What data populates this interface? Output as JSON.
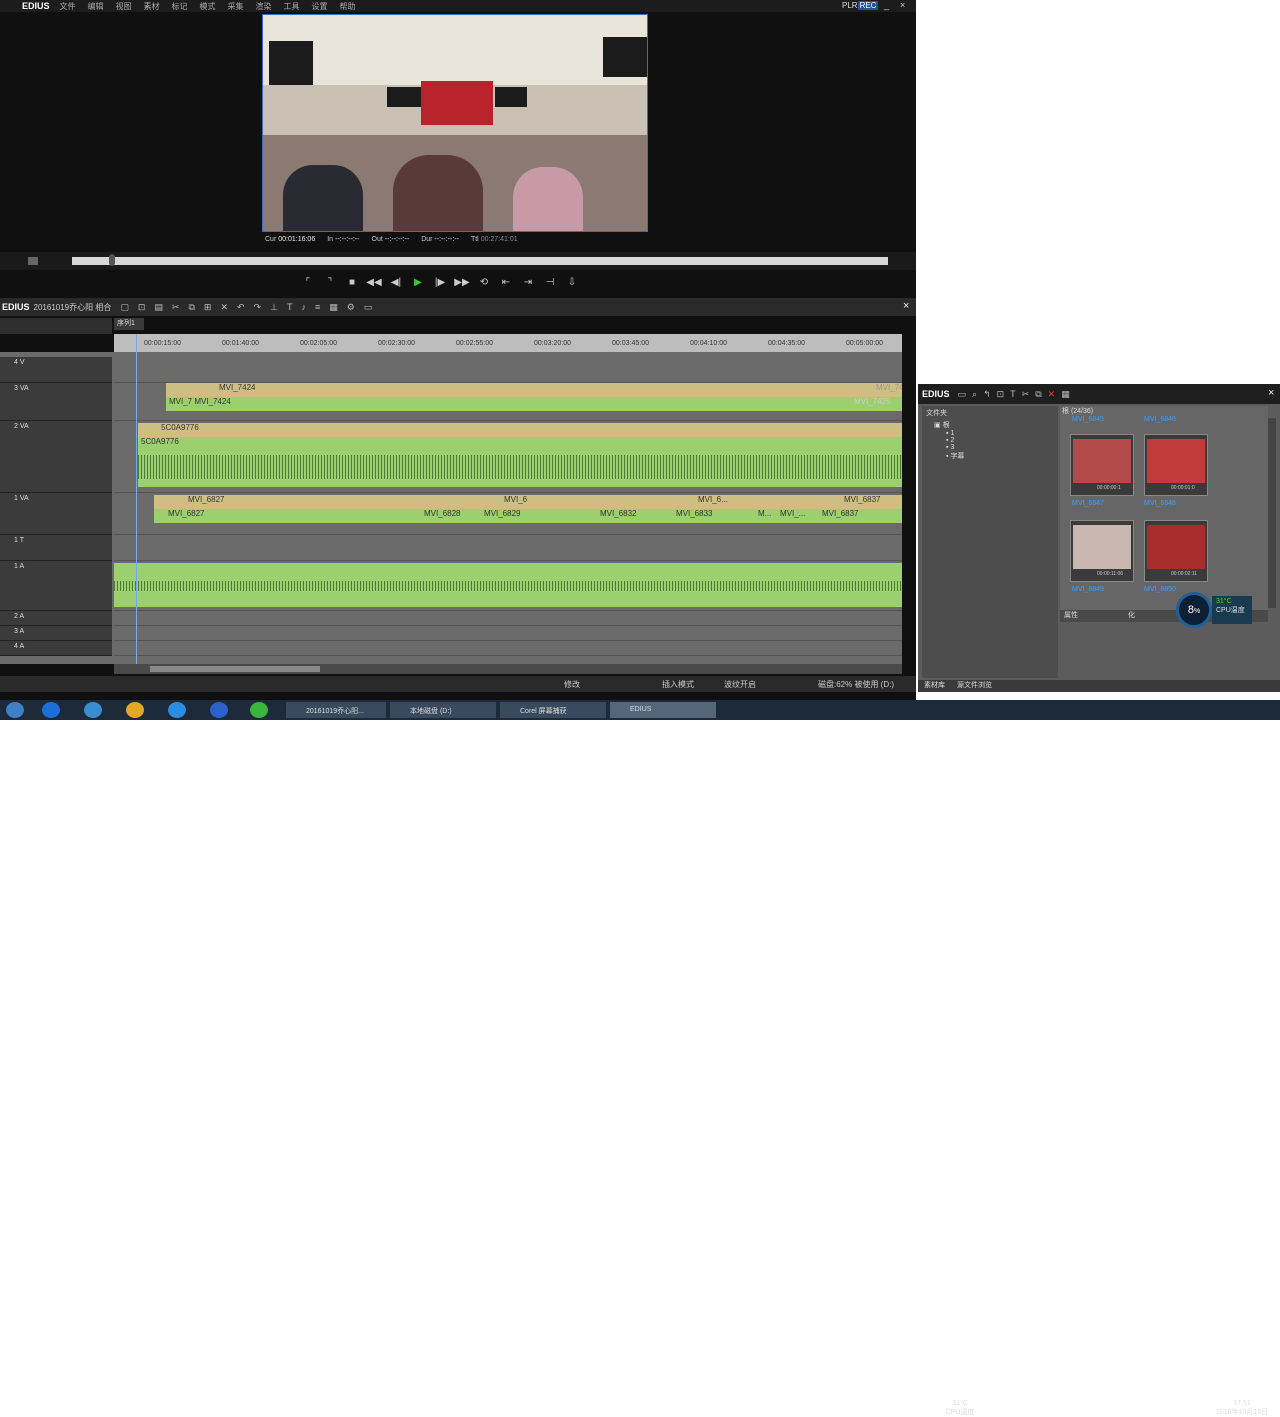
{
  "menubar": {
    "logo": "EDIUS",
    "items": [
      "文件",
      "编辑",
      "视图",
      "素材",
      "标记",
      "模式",
      "采集",
      "渲染",
      "工具",
      "设置",
      "帮助"
    ],
    "plr": "PLR",
    "rec": "REC",
    "min": "_",
    "close": "×"
  },
  "timecode": {
    "cur_label": "Cur",
    "cur": "00:01:16:06",
    "in_label": "In",
    "in": "--:--:--:--",
    "out_label": "Out",
    "out": "--:--:--:--",
    "dur_label": "Dur",
    "dur": "--:--:--:--",
    "ttl_label": "Ttl",
    "ttl": "00:27:41:01"
  },
  "timeline": {
    "title": "EDIUS",
    "project": "20161019乔心阳 相合",
    "sequence": "序列1",
    "close": "×",
    "ruler": [
      "00:00:15:00",
      "00:01:40:00",
      "00:02:05:00",
      "00:02:30:00",
      "00:02:55:00",
      "00:03:20:00",
      "00:03:45:00",
      "00:04:10:00",
      "00:04:35:00",
      "00:05:00:00"
    ],
    "tracks": [
      {
        "name": "4 V"
      },
      {
        "name": "3 VA"
      },
      {
        "name": "2 VA"
      },
      {
        "name": "1 VA"
      },
      {
        "name": "1 T"
      },
      {
        "name": "1 A"
      },
      {
        "name": "2 A"
      },
      {
        "name": "3 A"
      },
      {
        "name": "4 A"
      }
    ],
    "clips": {
      "t3_v1": "MVI_7424",
      "t3_a1": "MVI_7424",
      "t3_a0": "MVI_7",
      "t3_v2": "MVI_7425",
      "t3_a2": "MVI_7425",
      "t2_v": "5C0A9776",
      "t2_a": "5C0A9776",
      "t1_v": [
        "MVI_6827",
        "MVI_6",
        "MVI_6...",
        "MVI_6837"
      ],
      "t1_a": [
        "MVI_6827",
        "MVI_6828",
        "MVI_6829",
        "MVI_6832",
        "MVI_6833",
        "M...",
        "MVI_...",
        "MVI_6837"
      ]
    }
  },
  "status": {
    "a": "修改",
    "b": "插入模式",
    "c": "波纹开启",
    "d": "磁盘:62% 被使用 (D:)"
  },
  "bin": {
    "title": "EDIUS",
    "tree_label": "文件夹",
    "folder": "根",
    "sub": [
      "1",
      "2",
      "3",
      "字幕"
    ],
    "header": "根 (24/36)",
    "thumbs": [
      {
        "name": "MVI_6845"
      },
      {
        "name": "MVI_6846"
      },
      {
        "name": "MVI_6847",
        "tc": "00:00:00:1"
      },
      {
        "name": "MVI_6848",
        "tc": "00:00:01:0"
      },
      {
        "name": "MVI_6849",
        "tc": "00:00:11:06"
      },
      {
        "name": "MVI_6850",
        "tc": "00:00:02:11"
      }
    ],
    "attr_label": "属性",
    "attr_val": "化",
    "foot_a": "素材库",
    "foot_b": "源文件浏览"
  },
  "cpu": {
    "pct": "8",
    "unit": "%",
    "temp": "31°C",
    "temp_label": "CPU温度"
  },
  "taskbar": {
    "tasks": [
      "20161019乔心阳...",
      "本地磁盘 (D:)",
      "Corel 屏幕捕获",
      "EDIUS"
    ],
    "tray_temp": "31°C",
    "tray_label": "CPU温度",
    "time": "17:51",
    "date": "2016年10月19日"
  }
}
